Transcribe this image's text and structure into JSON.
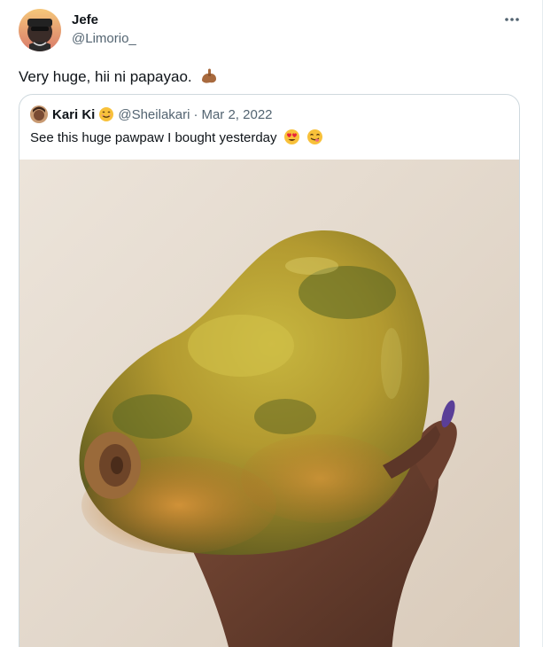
{
  "tweet": {
    "author": {
      "name": "Jefe",
      "handle": "@Limorio_"
    },
    "text": "Very huge, hii ni papayao.",
    "emoji_icon": "flexed-biceps-icon",
    "more_icon": "more-options-icon"
  },
  "quote": {
    "author": {
      "name": "Kari Ki",
      "handle": "@Sheilakari"
    },
    "separator": "·",
    "date": "Mar 2, 2022",
    "name_emoji_icon": "smiling-face-icon",
    "text": "See this huge pawpaw I bought yesterday",
    "text_emoji_icons": [
      "heart-eyes-icon",
      "yum-face-icon"
    ],
    "media": {
      "description_icon": "papaya-photo",
      "nail_color": "#5a3f98"
    }
  },
  "colors": {
    "text": "#0f1419",
    "secondary": "#536471",
    "border": "#cfd9de",
    "wall": "#e2d8cc",
    "papaya_yellow": "#c9b23c",
    "papaya_green": "#5d6a24",
    "papaya_orange": "#c4822f",
    "skin": "#6a4030"
  }
}
